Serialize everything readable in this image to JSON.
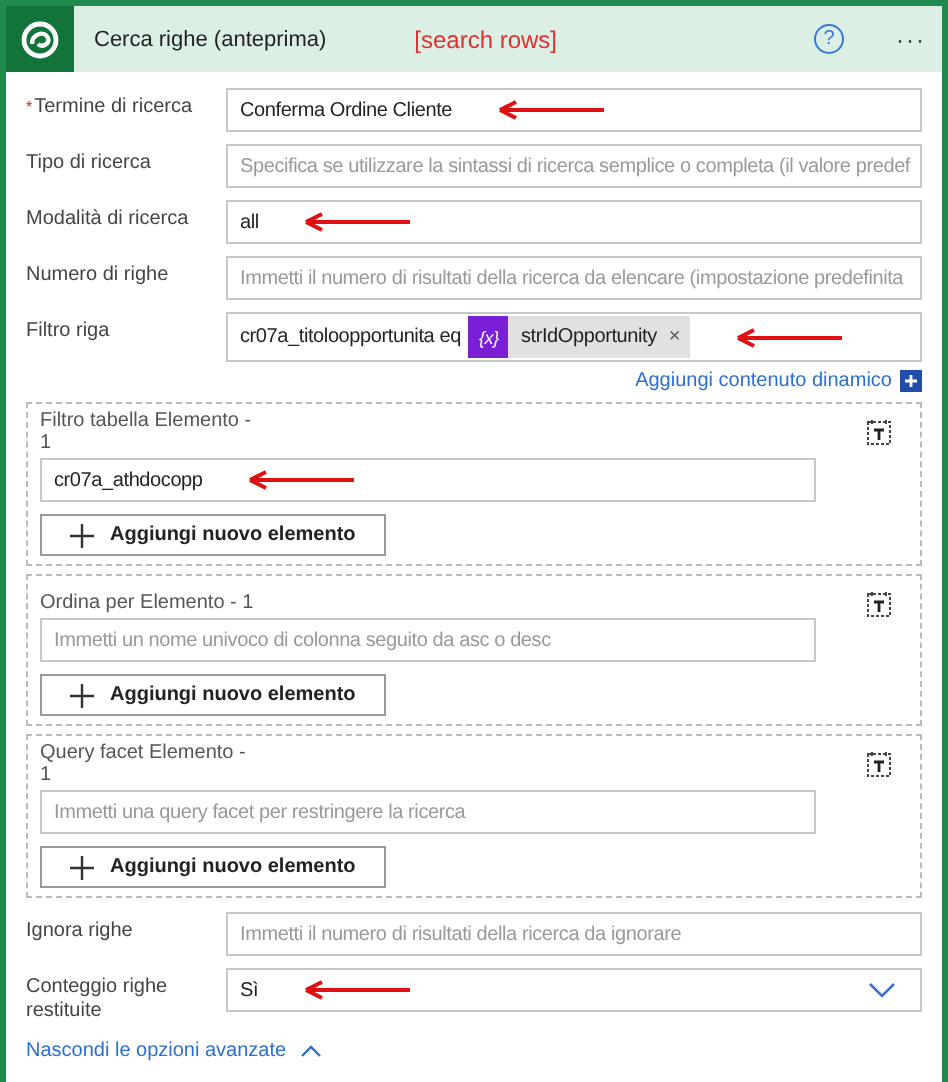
{
  "header": {
    "title": "Cerca righe (anteprima)",
    "annotation": "[search rows]",
    "help_icon": "?",
    "more_icon": "···"
  },
  "fields": [
    {
      "kind": "text",
      "label": "Termine di ricerca",
      "required_mark": "*",
      "value": "Conferma Ordine Cliente",
      "annotated": true
    },
    {
      "kind": "text",
      "label": "Tipo di ricerca",
      "placeholder": "Specifica se utilizzare la sintassi di ricerca semplice o completa (il valore predef"
    },
    {
      "kind": "text",
      "label": "Modalità di ricerca",
      "value": "all",
      "annotated": true
    },
    {
      "kind": "text",
      "label": "Numero di righe",
      "placeholder": "Immetti il numero di risultati della ricerca da elencare (impostazione predefinita"
    },
    {
      "kind": "filter",
      "label": "Filtro riga",
      "value": "cr07a_titoloopportunita eq",
      "token": {
        "icon": "{x}",
        "label": "strIdOpportunity",
        "remove": "×"
      },
      "annotated": true
    }
  ],
  "dynamic_link": "Aggiungi contenuto dinamico",
  "groups": [
    {
      "title": "Filtro tabella Elemento - 1",
      "value": "cr07a_athdocopp",
      "button": "Aggiungi nuovo elemento",
      "annotated": true,
      "wrap": true
    },
    {
      "title": "Ordina per Elemento - 1",
      "placeholder": "Immetti un nome univoco di colonna seguito da asc o desc",
      "button": "Aggiungi nuovo elemento",
      "wrap": false
    },
    {
      "title": "Query facet Elemento - 1",
      "placeholder": "Immetti una query facet per restringere la ricerca",
      "button": "Aggiungi nuovo elemento",
      "wrap": true
    }
  ],
  "fields_after": [
    {
      "kind": "text",
      "label": "Ignora righe",
      "placeholder": "Immetti il numero di risultati della ricerca da ignorare"
    },
    {
      "kind": "dropdown",
      "label": "Conteggio righe restituite",
      "value": "Sì",
      "annotated": true
    }
  ],
  "advanced_toggle": {
    "label": "Nascondi le opzioni avanzate",
    "expanded": true
  }
}
